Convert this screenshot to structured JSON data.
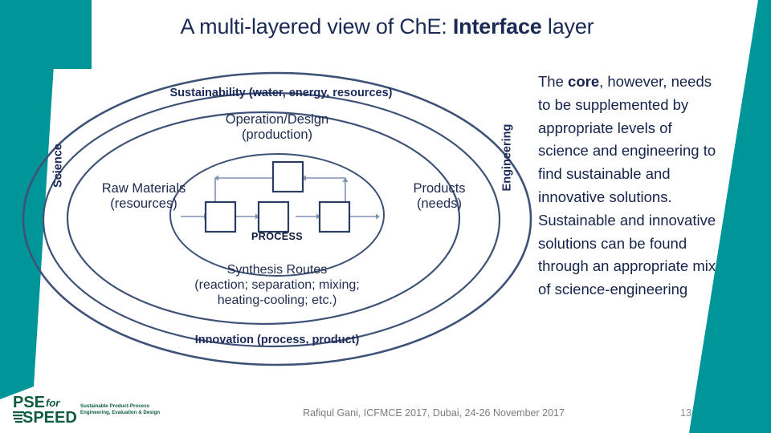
{
  "slide": {
    "title_prefix": "A multi-layered view of ChE: ",
    "title_emphasis": "Interface",
    "title_suffix": " layer",
    "accent_color": "#009599",
    "text_color": "#1b2a55"
  },
  "body": {
    "lead": "The ",
    "emphasis": "core",
    "rest": ", however, needs to be supplemented by appropriate levels of science and engineering to find sustainable and innovative solutions. Sustainable and innovative solutions can be found through an appropriate mix of science-engineering"
  },
  "diagram": {
    "outer_ring_label": "Sustainability (water, energy, resources)",
    "outer_ring_bottom_label": "Innovation (process, product)",
    "left_axis_label": "Science",
    "right_axis_label": "Engineering",
    "middle_ring_top_line1": "Operation/Design",
    "middle_ring_top_line2": "(production)",
    "left_node_line1": "Raw Materials",
    "left_node_line2": "(resources)",
    "right_node_line1": "Products",
    "right_node_line2": "(needs)",
    "core_label": "PROCESS",
    "synthesis_line1": "Synthesis Routes",
    "synthesis_line2": "(reaction; separation; mixing;",
    "synthesis_line3": "heating-cooling; etc.)",
    "ellipse_stroke": "#3e5277",
    "box_stroke": "#2b3c63",
    "arrow_color": "#7f93b5"
  },
  "footer": {
    "logo_pse": "PSE",
    "logo_for": "for",
    "logo_speed": "SPEED",
    "logo_tagline_line1": "Sustainable Product-Process",
    "logo_tagline_line2": "Engineering, Evaluation & Design",
    "logo_color": "#0c5c3d",
    "center_text": "Rafiqul Gani, ICFMCE 2017, Dubai, 24-26 November 2017",
    "page_number": "13"
  }
}
